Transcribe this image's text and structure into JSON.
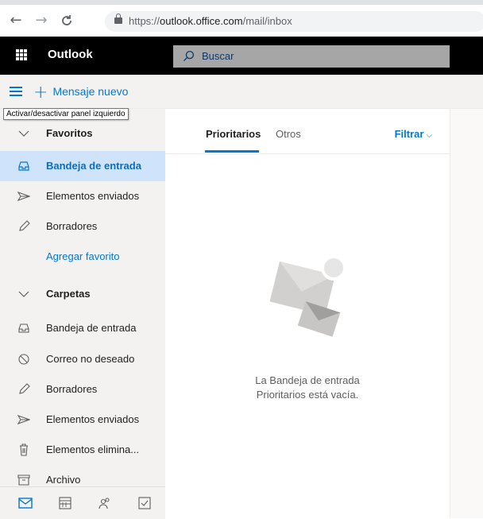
{
  "browser": {
    "back_icon": "arrow-left-icon",
    "forward_icon": "arrow-right-icon",
    "reload_icon": "reload-icon",
    "url_prefix": "https://",
    "url_host": "outlook.office.com",
    "url_path": "/mail/inbox"
  },
  "header": {
    "app_name": "Outlook",
    "search_placeholder": "Buscar"
  },
  "command_bar": {
    "new_message_label": "Mensaje nuevo",
    "tooltip": "Activar/desactivar panel izquierdo"
  },
  "sidebar": {
    "favorites_label": "Favoritos",
    "favorites": [
      {
        "label": "Bandeja de entrada",
        "icon": "inbox-icon",
        "selected": true
      },
      {
        "label": "Elementos enviados",
        "icon": "send-icon"
      },
      {
        "label": "Borradores",
        "icon": "pencil-icon"
      }
    ],
    "add_favorite_label": "Agregar favorito",
    "folders_label": "Carpetas",
    "folders": [
      {
        "label": "Bandeja de entrada",
        "icon": "inbox-icon"
      },
      {
        "label": "Correo no deseado",
        "icon": "blocked-icon"
      },
      {
        "label": "Borradores",
        "icon": "pencil-icon"
      },
      {
        "label": "Elementos enviados",
        "icon": "send-icon"
      },
      {
        "label": "Elementos elimina...",
        "icon": "trash-icon"
      },
      {
        "label": "Archivo",
        "icon": "archive-icon"
      }
    ],
    "bottom_icons": [
      "mail-icon",
      "calendar-icon",
      "people-icon",
      "tasks-icon"
    ]
  },
  "message_list": {
    "tabs": [
      {
        "label": "Prioritarios",
        "active": true
      },
      {
        "label": "Otros",
        "active": false
      }
    ],
    "filter_label": "Filtrar",
    "empty_line1": "La Bandeja de entrada",
    "empty_line2": "Prioritarios está vacía."
  },
  "colors": {
    "accent": "#0078d4",
    "header_bg": "#000000",
    "selected_bg": "#cfe4fa"
  }
}
